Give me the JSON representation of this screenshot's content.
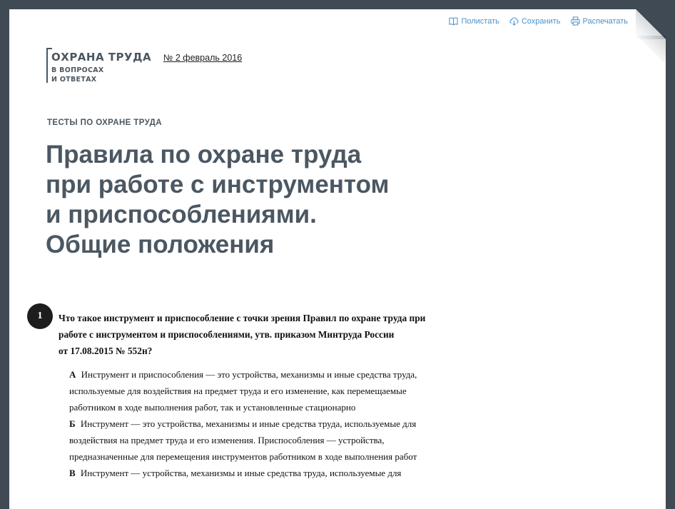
{
  "toolbar": {
    "items": [
      {
        "label": "Полистать",
        "icon": "book-icon"
      },
      {
        "label": "Сохранить",
        "icon": "cloud-download-icon"
      },
      {
        "label": "Распечатать",
        "icon": "printer-icon"
      }
    ]
  },
  "logo": {
    "line1": "ОХРАНА ТРУДА",
    "line2": "В ВОПРОСАХ",
    "line3": "И ОТВЕТАХ"
  },
  "issue": "№ 2 февраль 2016",
  "rubric": "ТЕСТЫ ПО ОХРАНЕ ТРУДА",
  "title": {
    "lines": [
      "Правила по охране труда",
      "при работе с инструментом",
      "и приспособлениями.",
      "Общие положения"
    ]
  },
  "question": {
    "number": "1",
    "lines": [
      "Что такое инструмент и приспособление с точки зрения Правил по охране труда при",
      "работе с инструментом и приспособлениями, утв. приказом Минтруда России",
      "от 17.08.2015 № 552н?"
    ]
  },
  "answers": [
    {
      "letter": "А",
      "lines": [
        "Инструмент и приспособления — это устройства, механизмы и иные средства труда,",
        "используемые для воздействия на предмет труда и его изменение, как перемещаемые",
        "работником в ходе выполнения работ, так и установленные стационарно"
      ]
    },
    {
      "letter": "Б",
      "lines": [
        "Инструмент — это устройства, механизмы и иные средства труда, используемые для",
        "воздействия на предмет труда и его изменения. Приспособления — устройства,",
        "предназначенные для перемещения инструментов работником в ходе выполнения работ"
      ]
    },
    {
      "letter": "В",
      "lines": [
        "Инструмент — устройства, механизмы и иные средства труда, используемые для"
      ]
    }
  ],
  "colors": {
    "background": "#3f4a54",
    "heading": "#4b5762",
    "link": "#4a90c8"
  }
}
